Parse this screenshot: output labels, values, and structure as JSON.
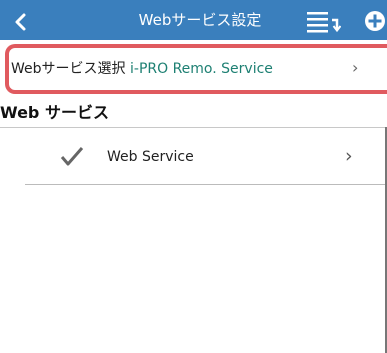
{
  "titlebar": {
    "title": "Webサービス設定",
    "back_icon": "chevron-left-icon",
    "sort_icon": "list-sort-icon",
    "add_icon": "plus-circle-icon",
    "color": "#3a7fbd"
  },
  "selection": {
    "label": "Webサービス選択",
    "value": "i-PRO Remo. Service",
    "chevron": "›",
    "value_color": "#1e8073",
    "highlight_color": "#e05a5f"
  },
  "section": {
    "title": "Web サービス"
  },
  "services": [
    {
      "label": "Web Service",
      "checked": true,
      "chevron": "›"
    }
  ]
}
